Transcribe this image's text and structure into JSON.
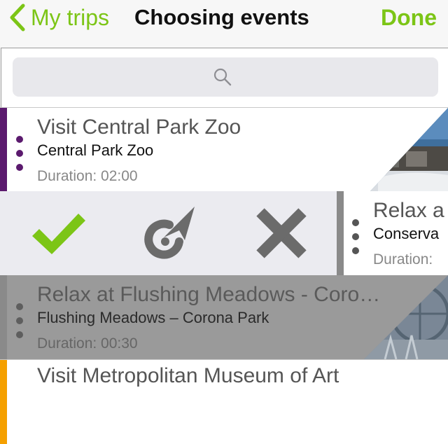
{
  "header": {
    "back_label": "My trips",
    "title": "Choosing events",
    "done_label": "Done"
  },
  "search": {
    "placeholder": ""
  },
  "events": [
    {
      "title": "Visit Central Park Zoo",
      "place": "Central Park Zoo",
      "duration": "Duration: 02:00",
      "stripe_color": "#5b1a6e"
    },
    {
      "title": "Relax a",
      "place": "Conserva",
      "duration": "Duration:"
    },
    {
      "title": "Relax at Flushing Meadows - Coro…",
      "place": "Flushing Meadows – Corona Park",
      "duration": "Duration: 00:30"
    },
    {
      "title": "Visit Metropolitan Museum of Art",
      "stripe_color": "#f5a000"
    }
  ],
  "actions": {
    "accept_icon": "checkmark-icon",
    "navigate_icon": "navigate-arrow-icon",
    "reject_icon": "close-x-icon"
  },
  "colors": {
    "accent": "#7cc516",
    "icon_gray": "#6b6b6b"
  }
}
